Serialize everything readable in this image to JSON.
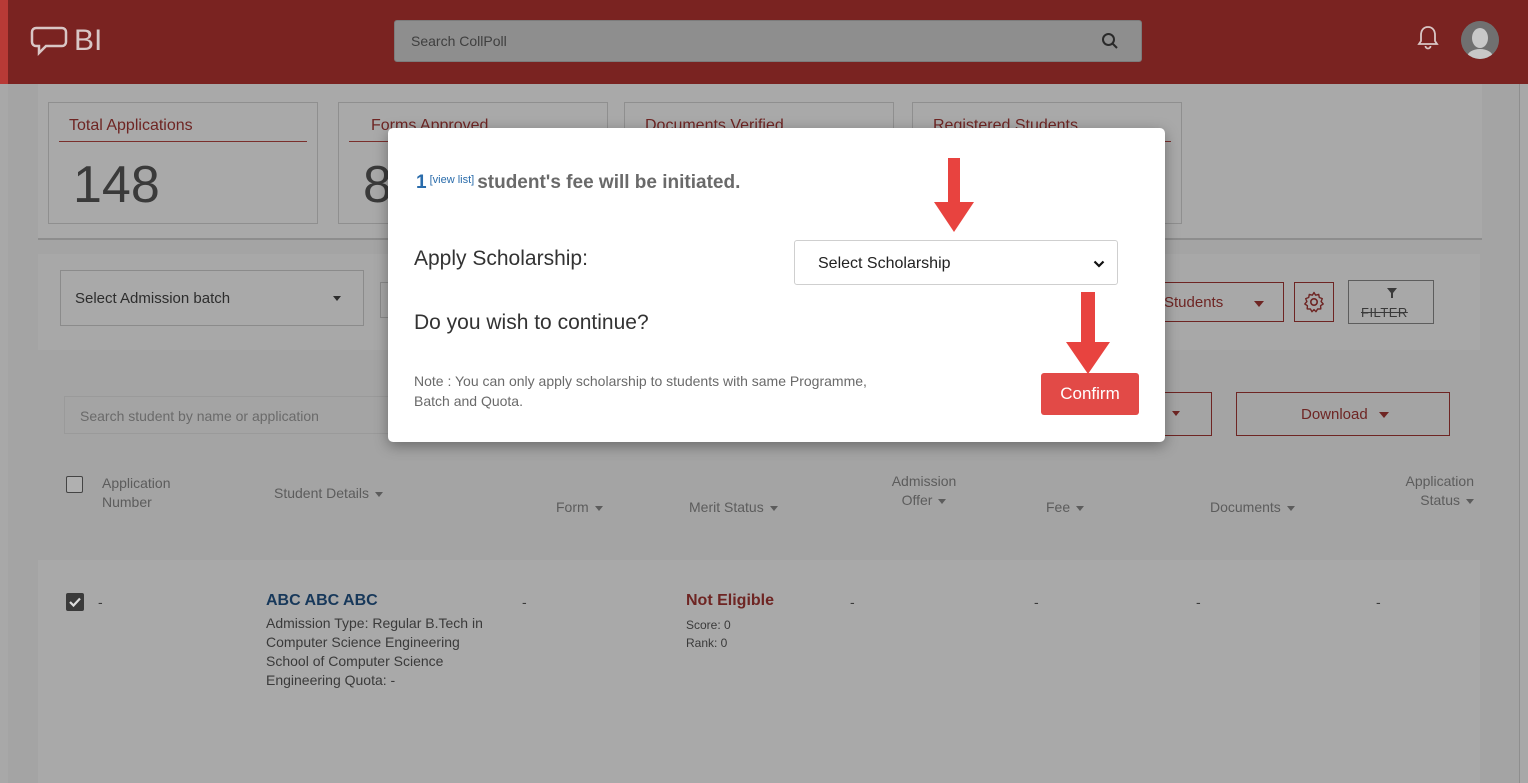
{
  "header": {
    "brand": "BI",
    "search_placeholder": "Search CollPoll"
  },
  "stats": [
    {
      "label": "Total Applications",
      "value": "148"
    },
    {
      "label": "Forms Approved",
      "value": "8"
    },
    {
      "label": "Documents Verified",
      "value": ""
    },
    {
      "label": "Registered Students",
      "value": ""
    }
  ],
  "filters": {
    "admission_batch": "Select Admission batch",
    "students_label": "Students",
    "filter_label": "FILTER"
  },
  "student_search_placeholder": "Search student by name or application",
  "download_label": "Download",
  "table": {
    "columns": [
      "Application Number",
      "Student Details",
      "Form",
      "Merit Status",
      "Admission Offer",
      "Fee",
      "Documents",
      "Application Status"
    ],
    "row": {
      "application_number": "-",
      "name": "ABC ABC ABC",
      "details": "Admission Type: Regular B.Tech in Computer Science Engineering School of Computer Science Engineering Quota: -",
      "form": "-",
      "merit_status": "Not Eligible",
      "score": "Score: 0",
      "rank": "Rank: 0",
      "admission_offer": "-",
      "fee": "-",
      "documents": "-",
      "application_status": "-"
    }
  },
  "modal": {
    "count": "1",
    "view_list": "[view list]",
    "message": "student's fee will be initiated.",
    "scholarship_label": "Apply Scholarship:",
    "scholarship_selected": "Select Scholarship",
    "continue_question": "Do you wish to continue?",
    "note": "Note : You can only apply scholarship to students with same Programme, Batch and Quota.",
    "confirm_label": "Confirm"
  },
  "colors": {
    "brand": "#7a2321",
    "confirm": "#e24a47",
    "arrow": "#e8433f",
    "link": "#2a6cab"
  }
}
